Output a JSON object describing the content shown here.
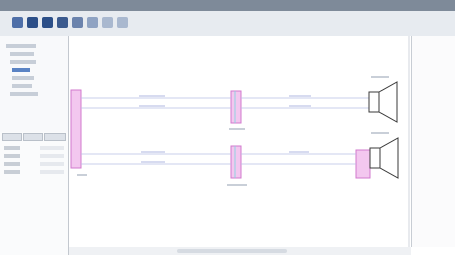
{
  "window": {
    "title": ""
  },
  "toolbar": {
    "buttons": [
      {
        "icon": "new-document-icon",
        "color": "#4e6fa8"
      },
      {
        "icon": "open-icon",
        "color": "#2c4f88"
      },
      {
        "icon": "save-icon",
        "color": "#2c4f88"
      },
      {
        "icon": "cut-icon",
        "color": "#3b5a8e"
      },
      {
        "icon": "copy-icon",
        "color": "#6b83ad"
      },
      {
        "icon": "paste-icon",
        "color": "#8fa3c3"
      },
      {
        "icon": "undo-icon",
        "color": "#a9b8cf"
      },
      {
        "icon": "redo-icon",
        "color": "#a9b8cf"
      }
    ]
  },
  "colors": {
    "wire": "#b8bfe4",
    "connector_fill": "#f3c7ef",
    "connector_stroke": "#d178cd",
    "speaker_stroke": "#3a3a3a",
    "accent": "#5a83c4"
  },
  "diagram": {
    "connectors": [],
    "speakers": []
  }
}
